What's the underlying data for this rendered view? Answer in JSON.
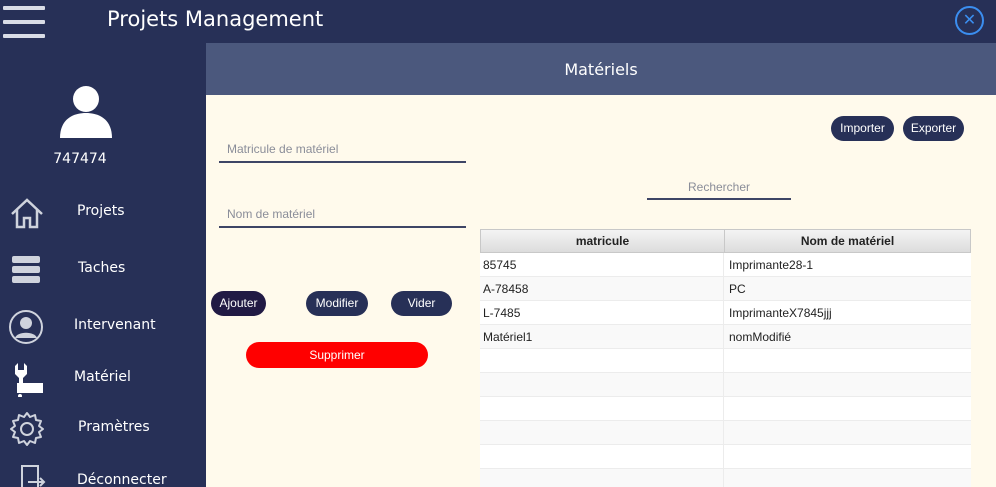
{
  "app": {
    "title": "Projets Management"
  },
  "user": {
    "id": "747474"
  },
  "nav": {
    "items": [
      {
        "label": "Projets",
        "icon": "home-icon"
      },
      {
        "label": "Taches",
        "icon": "stack-icon"
      },
      {
        "label": "Intervenant",
        "icon": "user-circle-icon"
      },
      {
        "label": "Matériel",
        "icon": "wrench-icon"
      },
      {
        "label": "Pramètres",
        "icon": "gear-icon"
      },
      {
        "label": "Déconnecter",
        "icon": "logout-icon"
      }
    ]
  },
  "page": {
    "title": "Matériels"
  },
  "form": {
    "matricule_placeholder": "Matricule de matériel",
    "nom_placeholder": "Nom de matériel",
    "add_label": "Ajouter",
    "edit_label": "Modifier",
    "clear_label": "Vider",
    "delete_label": "Supprimer"
  },
  "toolbar": {
    "import_label": "Importer",
    "export_label": "Exporter"
  },
  "search": {
    "placeholder": "Rechercher"
  },
  "table": {
    "headers": [
      "matricule",
      "Nom de matériel"
    ],
    "rows": [
      [
        "85745",
        "Imprimante28-1"
      ],
      [
        "A-78458",
        "PC"
      ],
      [
        "L-7485",
        "ImprimanteX7845jjj"
      ],
      [
        "Matériel1",
        "nomModifié"
      ],
      [
        "",
        ""
      ],
      [
        "",
        ""
      ],
      [
        "",
        ""
      ],
      [
        "",
        ""
      ],
      [
        "",
        ""
      ],
      [
        "",
        ""
      ]
    ]
  },
  "colors": {
    "sidebar": "#273057",
    "header": "#4b587d",
    "background": "#fffaec",
    "delete": "#ff0000",
    "close": "#3b8ef0"
  }
}
